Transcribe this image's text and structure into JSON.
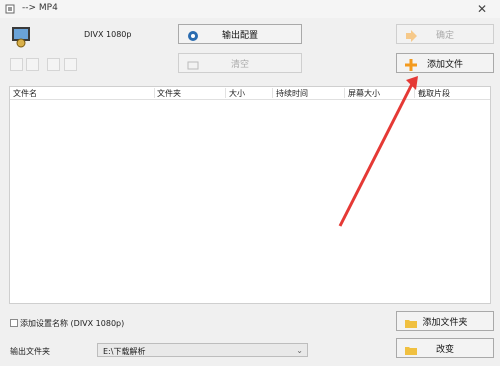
{
  "window": {
    "title": "--> MP4",
    "close_glyph": "✕"
  },
  "format": {
    "label": "DIVX 1080p"
  },
  "buttons": {
    "output_config": "输出配置",
    "clear": "清空",
    "ok": "确定",
    "add_file": "添加文件",
    "add_folder": "添加文件夹",
    "change": "改变"
  },
  "table": {
    "columns": [
      "文件名",
      "文件夹",
      "大小",
      "持续时间",
      "屏幕大小",
      "截取片段"
    ]
  },
  "options": {
    "add_setting_name": "添加设置名称 (DIVX 1080p)"
  },
  "output": {
    "label": "输出文件夹",
    "path": "E:\\下载解析",
    "dropdown_glyph": "⌄"
  },
  "colors": {
    "accent_orange": "#f39a1e",
    "arrow_red": "#e53935"
  }
}
